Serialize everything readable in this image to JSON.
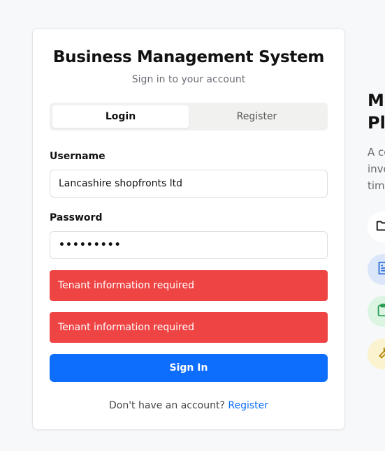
{
  "login_card": {
    "title": "Business Management System",
    "subtitle": "Sign in to your account",
    "tabs": [
      {
        "label": "Login",
        "active": true
      },
      {
        "label": "Register",
        "active": false
      }
    ],
    "username": {
      "label": "Username",
      "value": "Lancashire shopfronts ltd"
    },
    "password": {
      "label": "Password",
      "value": "•••••••••"
    },
    "alerts": [
      "Tenant information required",
      "Tenant information required"
    ],
    "sign_in_label": "Sign In",
    "footer_text": "Don't have an account?",
    "register_link": "Register"
  },
  "right_panel": {
    "title": "Ma\nPla",
    "description": "A co\ninvo\ntime",
    "features": [
      {
        "icon": "folder-icon",
        "bg": "#ffffff",
        "color": "#111111"
      },
      {
        "icon": "document-icon",
        "bg": "#dbe6fb",
        "color": "#2f6fd6"
      },
      {
        "icon": "clipboard-icon",
        "bg": "#dcf5e3",
        "color": "#2a9d55"
      },
      {
        "icon": "wrench-icon",
        "bg": "#fbf3cf",
        "color": "#b8860b"
      }
    ]
  },
  "colors": {
    "primary": "#0d6efd",
    "danger": "#ef4444"
  }
}
